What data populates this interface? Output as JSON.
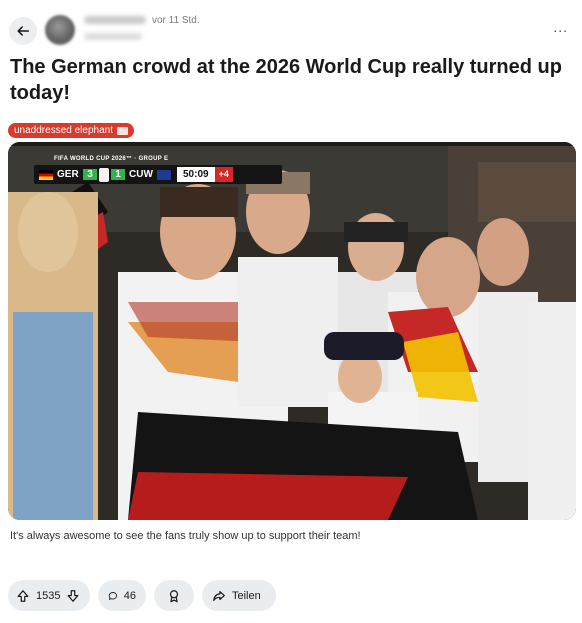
{
  "header": {
    "back_icon": "arrow-left-icon",
    "timestamp": "vor 11 Std.",
    "more_label": "..."
  },
  "post": {
    "title": "The German crowd at the 2026 World Cup really turned up today!",
    "flair": {
      "label": "unaddressed elephant",
      "color": "#d93a2b",
      "icon": "elephant-icon"
    },
    "caption": "It's always awesome to see the fans truly show up to support their team!"
  },
  "scoreboard": {
    "event": "FIFA WORLD CUP 2026™ · GROUP E",
    "home_team": "GER",
    "home_score": "3",
    "away_score": "1",
    "away_team": "CUW",
    "clock": "50:09",
    "added_time": "+4"
  },
  "actions": {
    "upvote_icon": "arrow-up-icon",
    "vote_count": "1535",
    "downvote_icon": "arrow-down-icon",
    "comment_icon": "comment-bubble-icon",
    "comment_count": "46",
    "award_icon": "award-icon",
    "share_icon": "share-arrow-icon",
    "share_label": "Teilen"
  },
  "colors": {
    "flair_bg": "#d93a2b",
    "pill_bg": "#eaedef",
    "scoreboard_green": "#2fb34a",
    "scoreboard_red": "#d62828"
  }
}
